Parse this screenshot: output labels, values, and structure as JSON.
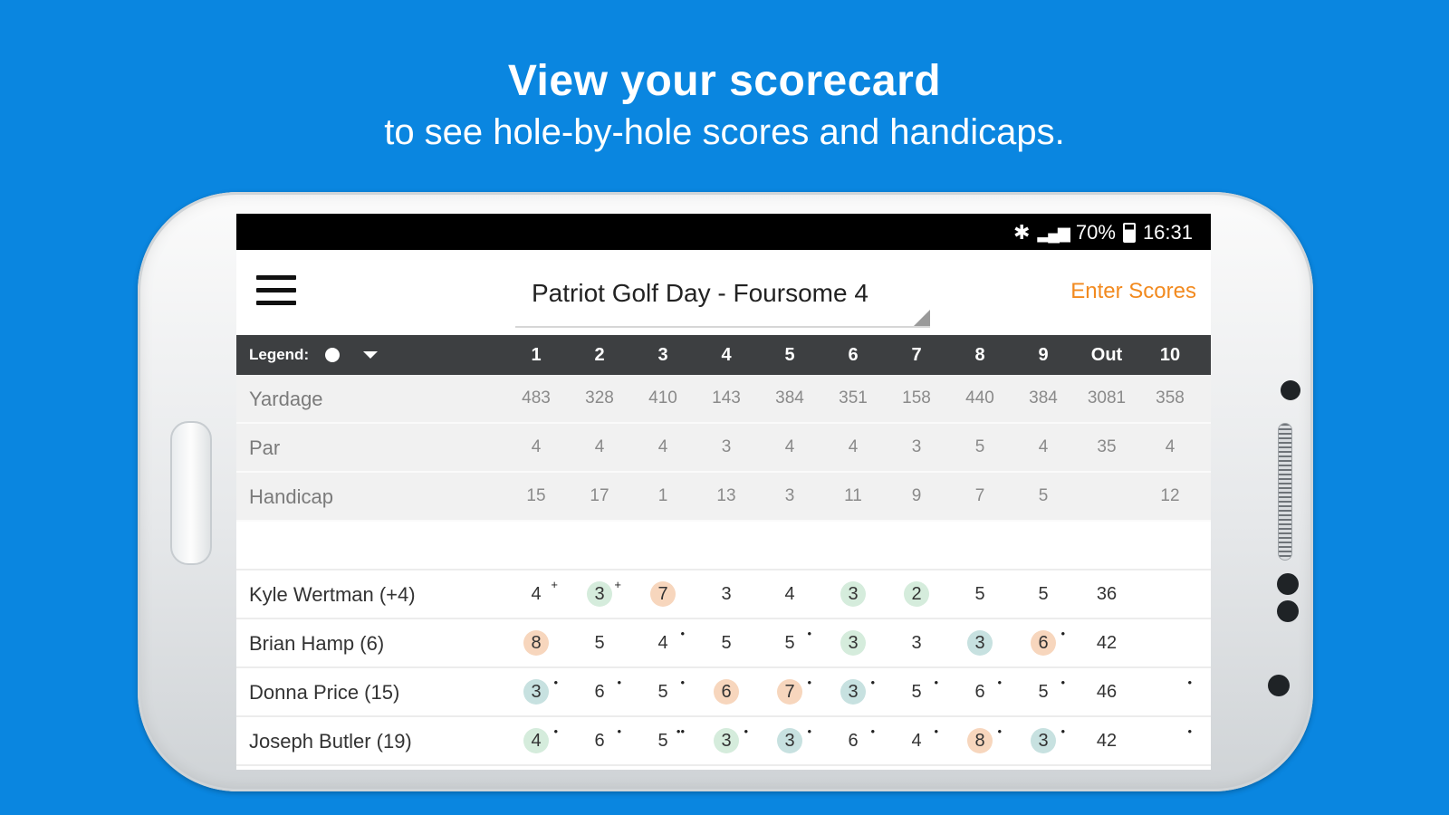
{
  "promo": {
    "headline": "View your scorecard",
    "subline": "to see hole-by-hole scores and handicaps."
  },
  "status": {
    "battery": "70%",
    "time": "16:31"
  },
  "app": {
    "title": "Patriot Golf Day - Foursome 4",
    "enter_scores": "Enter Scores",
    "legend_label": "Legend:"
  },
  "columns": [
    "1",
    "2",
    "3",
    "4",
    "5",
    "6",
    "7",
    "8",
    "9",
    "Out",
    "10"
  ],
  "info_rows": [
    {
      "label": "Yardage",
      "values": [
        "483",
        "328",
        "410",
        "143",
        "384",
        "351",
        "158",
        "440",
        "384",
        "3081",
        "358"
      ]
    },
    {
      "label": "Par",
      "values": [
        "4",
        "4",
        "4",
        "3",
        "4",
        "4",
        "3",
        "5",
        "4",
        "35",
        "4"
      ]
    },
    {
      "label": "Handicap",
      "values": [
        "15",
        "17",
        "1",
        "13",
        "3",
        "11",
        "9",
        "7",
        "5",
        "",
        "12"
      ]
    }
  ],
  "players": [
    {
      "name": "Kyle Wertman (+4)",
      "scores": [
        {
          "v": "4",
          "c": "white",
          "s": "+"
        },
        {
          "v": "3",
          "c": "green",
          "s": "+"
        },
        {
          "v": "7",
          "c": "orange",
          "s": ""
        },
        {
          "v": "3",
          "c": "white",
          "s": ""
        },
        {
          "v": "4",
          "c": "white",
          "s": ""
        },
        {
          "v": "3",
          "c": "green",
          "s": ""
        },
        {
          "v": "2",
          "c": "green",
          "s": ""
        },
        {
          "v": "5",
          "c": "white",
          "s": ""
        },
        {
          "v": "5",
          "c": "white",
          "s": ""
        },
        {
          "v": "36",
          "c": "white",
          "s": ""
        },
        {
          "v": "",
          "c": "white",
          "s": ""
        }
      ]
    },
    {
      "name": "Brian Hamp (6)",
      "scores": [
        {
          "v": "8",
          "c": "orange",
          "s": ""
        },
        {
          "v": "5",
          "c": "white",
          "s": ""
        },
        {
          "v": "4",
          "c": "white",
          "s": "•"
        },
        {
          "v": "5",
          "c": "white",
          "s": ""
        },
        {
          "v": "5",
          "c": "white",
          "s": "•"
        },
        {
          "v": "3",
          "c": "green",
          "s": ""
        },
        {
          "v": "3",
          "c": "white",
          "s": ""
        },
        {
          "v": "3",
          "c": "teal",
          "s": ""
        },
        {
          "v": "6",
          "c": "orange",
          "s": "•"
        },
        {
          "v": "42",
          "c": "white",
          "s": ""
        },
        {
          "v": "",
          "c": "white",
          "s": ""
        }
      ]
    },
    {
      "name": "Donna Price (15)",
      "scores": [
        {
          "v": "3",
          "c": "teal",
          "s": "•"
        },
        {
          "v": "6",
          "c": "white",
          "s": "•"
        },
        {
          "v": "5",
          "c": "white",
          "s": "•"
        },
        {
          "v": "6",
          "c": "orange",
          "s": ""
        },
        {
          "v": "7",
          "c": "orange",
          "s": "•"
        },
        {
          "v": "3",
          "c": "teal",
          "s": "•"
        },
        {
          "v": "5",
          "c": "white",
          "s": "•"
        },
        {
          "v": "6",
          "c": "white",
          "s": "•"
        },
        {
          "v": "5",
          "c": "white",
          "s": "•"
        },
        {
          "v": "46",
          "c": "white",
          "s": ""
        },
        {
          "v": "",
          "c": "white",
          "s": "•"
        }
      ]
    },
    {
      "name": "Joseph Butler (19)",
      "scores": [
        {
          "v": "4",
          "c": "green",
          "s": "•"
        },
        {
          "v": "6",
          "c": "white",
          "s": "•"
        },
        {
          "v": "5",
          "c": "white",
          "s": "••"
        },
        {
          "v": "3",
          "c": "green",
          "s": "•"
        },
        {
          "v": "3",
          "c": "teal",
          "s": "•"
        },
        {
          "v": "6",
          "c": "white",
          "s": "•"
        },
        {
          "v": "4",
          "c": "white",
          "s": "•"
        },
        {
          "v": "8",
          "c": "orange",
          "s": "•"
        },
        {
          "v": "3",
          "c": "teal",
          "s": "•"
        },
        {
          "v": "42",
          "c": "white",
          "s": ""
        },
        {
          "v": "",
          "c": "white",
          "s": "•"
        }
      ]
    }
  ],
  "icons": {
    "menu": "hamburger-menu-icon",
    "bluetooth": "bluetooth-icon",
    "signal": "signal-icon",
    "battery": "battery-icon"
  },
  "colors": {
    "background": "#0a86e0",
    "accent": "#f28a1f",
    "header_bar": "#3d3f41"
  }
}
